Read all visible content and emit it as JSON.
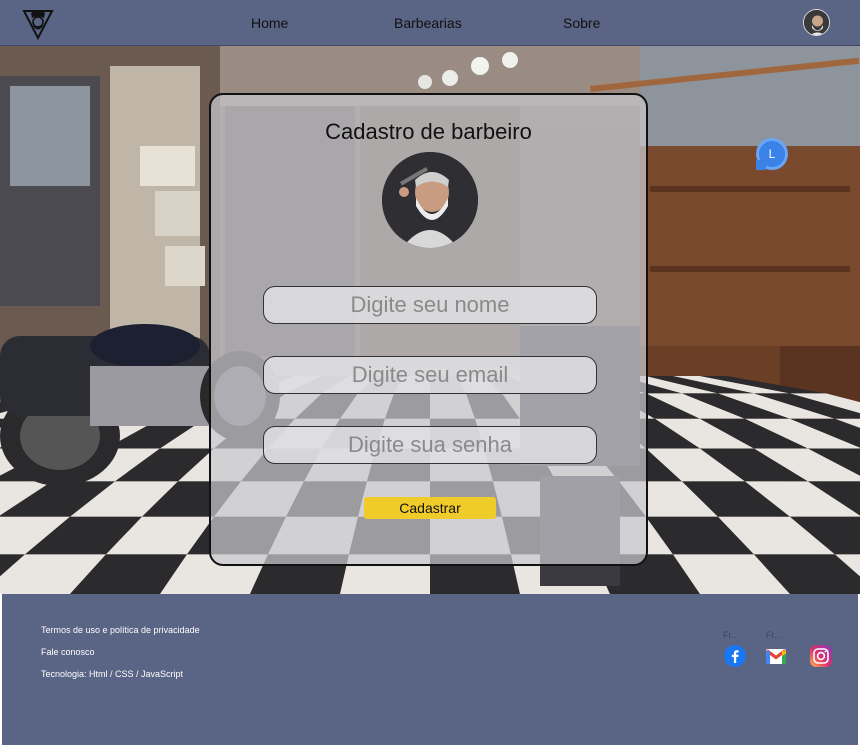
{
  "nav": {
    "home": "Home",
    "barbearias": "Barbearias",
    "sobre": "Sobre"
  },
  "form": {
    "title": "Cadastro de barbeiro",
    "name_placeholder": "Digite seu nome",
    "email_placeholder": "Digite seu email",
    "password_placeholder": "Digite sua senha",
    "submit_label": "Cadastrar"
  },
  "badge": {
    "letter": "L"
  },
  "footer": {
    "terms": "Termos de uso e política de privacidade",
    "contact": "Fale conosco",
    "tech": "Tecnologia: Html / CSS / JavaScript",
    "social_labels": [
      "Fr...",
      "Fr..."
    ],
    "social_icons": [
      "facebook-icon",
      "gmail-icon",
      "instagram-icon"
    ]
  },
  "colors": {
    "header_bg": "#5a6485",
    "footer_bg": "#5a6485",
    "button_bg": "#f0cc2a",
    "badge_bg": "#3b82e8"
  }
}
